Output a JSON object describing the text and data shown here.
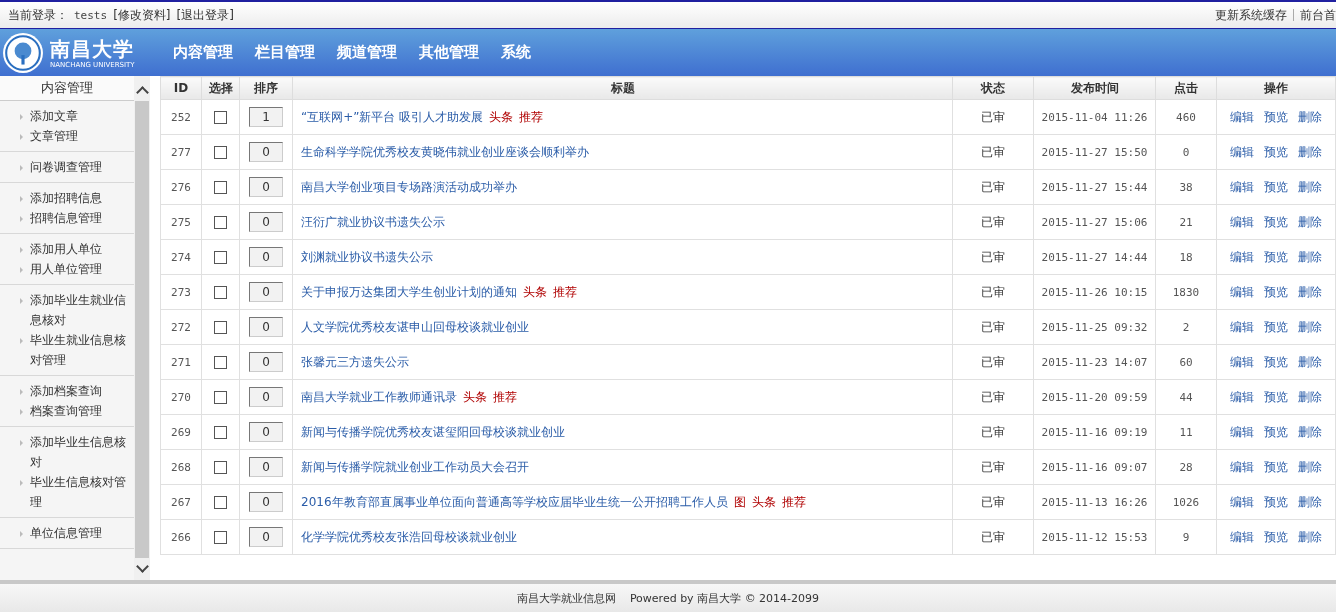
{
  "topbar": {
    "login_label": "当前登录：",
    "username": "tests",
    "links": [
      "[修改资料]",
      "[退出登录]"
    ],
    "right_links": [
      "更新系统缓存",
      "前台首"
    ]
  },
  "logo": {
    "name": "南昌大学",
    "subtitle": "NANCHANG UNIVERSITY"
  },
  "nav": [
    {
      "label": "内容管理"
    },
    {
      "label": "栏目管理"
    },
    {
      "label": "频道管理"
    },
    {
      "label": "其他管理"
    },
    {
      "label": "系统"
    }
  ],
  "sidebar": {
    "title": "内容管理",
    "groups": [
      [
        "添加文章",
        "文章管理"
      ],
      [
        "问卷调查管理"
      ],
      [
        "添加招聘信息",
        "招聘信息管理"
      ],
      [
        "添加用人单位",
        "用人单位管理"
      ],
      [
        "添加毕业生就业信息核对",
        "毕业生就业信息核对管理"
      ],
      [
        "添加档案查询",
        "档案查询管理"
      ],
      [
        "添加毕业生信息核对",
        "毕业生信息核对管理"
      ],
      [
        "单位信息管理"
      ]
    ]
  },
  "table": {
    "columns": [
      "ID",
      "选择",
      "排序",
      "标题",
      "状态",
      "发布时间",
      "点击",
      "操作"
    ],
    "rows": [
      {
        "id": "252",
        "checked": false,
        "sort": "1",
        "title": "“互联网+”新平台 吸引人才助发展",
        "tags": [
          "头条",
          "推荐"
        ],
        "status": "已审",
        "date": "2015-11-04 11:26",
        "clicks": "460",
        "actions": [
          "编辑",
          "预览",
          "删除"
        ]
      },
      {
        "id": "277",
        "checked": false,
        "sort": "0",
        "title": "生命科学学院优秀校友黄晓伟就业创业座谈会顺利举办",
        "tags": [],
        "status": "已审",
        "date": "2015-11-27 15:50",
        "clicks": "0",
        "actions": [
          "编辑",
          "预览",
          "删除"
        ]
      },
      {
        "id": "276",
        "checked": false,
        "sort": "0",
        "title": "南昌大学创业项目专场路演活动成功举办",
        "tags": [],
        "status": "已审",
        "date": "2015-11-27 15:44",
        "clicks": "38",
        "actions": [
          "编辑",
          "预览",
          "删除"
        ]
      },
      {
        "id": "275",
        "checked": false,
        "sort": "0",
        "title": "汪衍广就业协议书遗失公示",
        "tags": [],
        "status": "已审",
        "date": "2015-11-27 15:06",
        "clicks": "21",
        "actions": [
          "编辑",
          "预览",
          "删除"
        ]
      },
      {
        "id": "274",
        "checked": false,
        "sort": "0",
        "title": "刘渊就业协议书遗失公示",
        "tags": [],
        "status": "已审",
        "date": "2015-11-27 14:44",
        "clicks": "18",
        "actions": [
          "编辑",
          "预览",
          "删除"
        ]
      },
      {
        "id": "273",
        "checked": false,
        "sort": "0",
        "title": "关于申报万达集团大学生创业计划的通知",
        "tags": [
          "头条",
          "推荐"
        ],
        "status": "已审",
        "date": "2015-11-26 10:15",
        "clicks": "1830",
        "actions": [
          "编辑",
          "预览",
          "删除"
        ]
      },
      {
        "id": "272",
        "checked": false,
        "sort": "0",
        "title": "人文学院优秀校友谌申山回母校谈就业创业",
        "tags": [],
        "status": "已审",
        "date": "2015-11-25 09:32",
        "clicks": "2",
        "actions": [
          "编辑",
          "预览",
          "删除"
        ]
      },
      {
        "id": "271",
        "checked": false,
        "sort": "0",
        "title": "张馨元三方遗失公示",
        "tags": [],
        "status": "已审",
        "date": "2015-11-23 14:07",
        "clicks": "60",
        "actions": [
          "编辑",
          "预览",
          "删除"
        ]
      },
      {
        "id": "270",
        "checked": false,
        "sort": "0",
        "title": "南昌大学就业工作教师通讯录",
        "tags": [
          "头条",
          "推荐"
        ],
        "status": "已审",
        "date": "2015-11-20 09:59",
        "clicks": "44",
        "actions": [
          "编辑",
          "预览",
          "删除"
        ]
      },
      {
        "id": "269",
        "checked": false,
        "sort": "0",
        "title": "新闻与传播学院优秀校友谌玺阳回母校谈就业创业",
        "tags": [],
        "status": "已审",
        "date": "2015-11-16 09:19",
        "clicks": "11",
        "actions": [
          "编辑",
          "预览",
          "删除"
        ]
      },
      {
        "id": "268",
        "checked": false,
        "sort": "0",
        "title": "新闻与传播学院就业创业工作动员大会召开",
        "tags": [],
        "status": "已审",
        "date": "2015-11-16 09:07",
        "clicks": "28",
        "actions": [
          "编辑",
          "预览",
          "删除"
        ]
      },
      {
        "id": "267",
        "checked": false,
        "sort": "0",
        "title": "2016年教育部直属事业单位面向普通高等学校应届毕业生统一公开招聘工作人员",
        "tags": [
          "图",
          "头条",
          "推荐"
        ],
        "status": "已审",
        "date": "2015-11-13 16:26",
        "clicks": "1026",
        "actions": [
          "编辑",
          "预览",
          "删除"
        ]
      },
      {
        "id": "266",
        "checked": false,
        "sort": "0",
        "title": "化学学院优秀校友张浩回母校谈就业创业",
        "tags": [],
        "status": "已审",
        "date": "2015-11-12 15:53",
        "clicks": "9",
        "actions": [
          "编辑",
          "预览",
          "删除"
        ]
      }
    ]
  },
  "footer": "南昌大学就业信息网    Powered by 南昌大学 © 2014-2099"
}
